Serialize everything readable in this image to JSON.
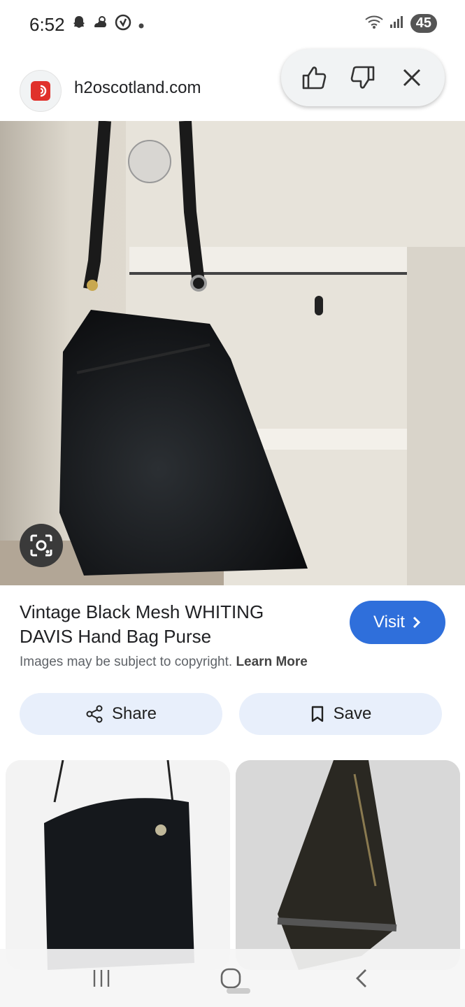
{
  "status_bar": {
    "time": "6:52",
    "battery": "45",
    "left_icons": [
      "snapchat-icon",
      "weather-icon",
      "vpn-icon",
      "dot-icon"
    ],
    "right_icons": [
      "wifi-icon",
      "signal-icon",
      "battery-icon"
    ]
  },
  "header": {
    "site": "h2oscotland.com",
    "feedback": [
      "thumbs-up-icon",
      "thumbs-down-icon",
      "close-icon"
    ]
  },
  "result": {
    "title": "Vintage Black Mesh WHITING DAVIS Hand Bag Purse",
    "visit_label": "Visit",
    "copyright_text": "Images may be subject to copyright.",
    "learn_more": "Learn More",
    "share_label": "Share",
    "save_label": "Save"
  },
  "colors": {
    "visit": "#2f6fdb",
    "action_bg": "#e8effb",
    "favicon": "#e0312b"
  }
}
